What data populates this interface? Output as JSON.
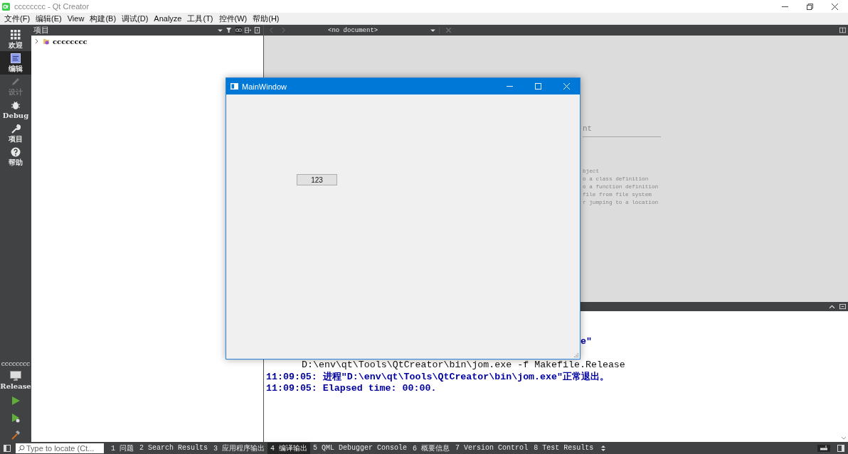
{
  "window": {
    "title": "cccccccc - Qt Creator"
  },
  "menu": [
    "文件(F)",
    "编辑(E)",
    "View",
    "构建(B)",
    "调试(D)",
    "Analyze",
    "工具(T)",
    "控件(W)",
    "帮助(H)"
  ],
  "modes": [
    {
      "label": "欢迎",
      "kind": "welcome",
      "selected": false,
      "disabled": false
    },
    {
      "label": "编辑",
      "kind": "edit",
      "selected": true,
      "disabled": false
    },
    {
      "label": "设计",
      "kind": "design",
      "selected": false,
      "disabled": true
    },
    {
      "label": "Debug",
      "kind": "debug",
      "selected": false,
      "disabled": false
    },
    {
      "label": "项目",
      "kind": "projects",
      "selected": false,
      "disabled": false
    },
    {
      "label": "帮助",
      "kind": "help",
      "selected": false,
      "disabled": false
    }
  ],
  "target": {
    "project": "cccccccc",
    "config": "Release"
  },
  "projects_pane": {
    "title": "项目",
    "tree": [
      {
        "label": "cccccccc",
        "expanded": false
      }
    ]
  },
  "editor": {
    "document": "<no document>",
    "heading": "nt",
    "hints": [
      "bject",
      "o a class definition",
      "o a function definition",
      "file from file system",
      "r jumping to a location"
    ]
  },
  "output": {
    "lines": [
      {
        "kind": "message",
        "text": "e\""
      },
      {
        "kind": "command",
        "text": "D:\\env\\qt\\Tools\\QtCreator\\bin\\jom.exe -f Makefile.Release"
      },
      {
        "kind": "message",
        "text": "11:09:05: 进程\"D:\\env\\qt\\Tools\\QtCreator\\bin\\jom.exe\"正常退出。"
      },
      {
        "kind": "message",
        "text": "11:09:05: Elapsed time: 00:00."
      }
    ]
  },
  "app_window": {
    "title": "MainWindow",
    "button": "123"
  },
  "locator": {
    "placeholder": "Type to locate (Ct..."
  },
  "output_tabs": [
    {
      "label": "1 问题",
      "selected": false
    },
    {
      "label": "2 Search Results",
      "selected": false
    },
    {
      "label": "3 应用程序输出",
      "selected": false
    },
    {
      "label": "4 编译输出",
      "selected": true
    },
    {
      "label": "5 QML Debugger Console",
      "selected": false
    },
    {
      "label": "6 概要信息",
      "selected": false
    },
    {
      "label": "7 Version Control",
      "selected": false
    },
    {
      "label": "8 Test Results",
      "selected": false
    }
  ]
}
